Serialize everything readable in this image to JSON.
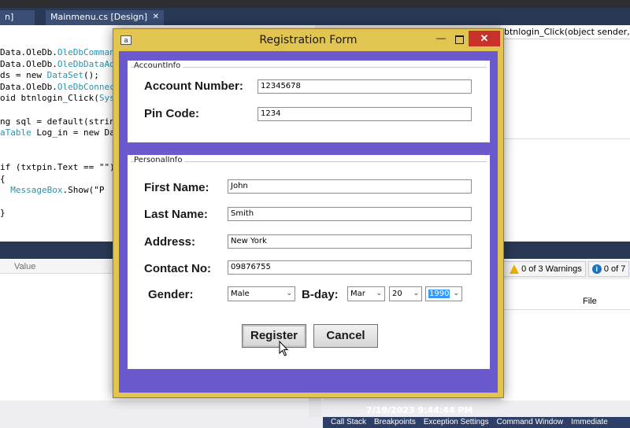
{
  "ide": {
    "tabs": [
      {
        "label": "n]"
      },
      {
        "label": "Mainmenu.cs [Design]"
      }
    ],
    "tab_close_glyph": "✕",
    "method_bar": "btnlogin_Click(object sender, EventArgs e)",
    "code_lines": [
      {
        "pre": "Data.OleDb.",
        "type": "OleDbCommand",
        "post": ""
      },
      {
        "pre": "Data.OleDb.",
        "type": "OleDbDataAda",
        "post": ""
      },
      {
        "pre": "ds = new ",
        "type": "DataSet",
        "post": "();"
      },
      {
        "pre": "Data.OleDb.",
        "type": "OleDbConnect",
        "post": ""
      },
      {
        "pre": "oid btnlogin_Click(",
        "type": "Sys",
        "post": ""
      },
      {
        "pre": "",
        "type": "",
        "post": ""
      },
      {
        "pre": "ng sql = default(strin",
        "type": "",
        "post": ""
      },
      {
        "pre": "",
        "type": "aTable",
        "post": " Log_in = new Dat"
      },
      {
        "pre": "",
        "type": "",
        "post": ""
      },
      {
        "pre": "",
        "type": "",
        "post": ""
      },
      {
        "pre": "if (txtpin.Text == \"\")",
        "type": "",
        "post": ""
      },
      {
        "pre": "{",
        "type": "",
        "post": ""
      },
      {
        "pre": "  ",
        "type": "MessageBox",
        "post": ".Show(\"P"
      },
      {
        "pre": "",
        "type": "",
        "post": ""
      },
      {
        "pre": "}",
        "type": "",
        "post": ""
      }
    ],
    "value_header": "Value",
    "warnings_label": "0 of 3 Warnings",
    "messages_label": "0 of 7",
    "file_header": "File",
    "bottom_tabs": [
      "Call Stack",
      "Breakpoints",
      "Exception Settings",
      "Command Window",
      "Immediate"
    ]
  },
  "window": {
    "icon_glyph": "a",
    "title": "Registration Form",
    "minimize_glyph": "—",
    "close_glyph": "✕"
  },
  "account_group": {
    "label": "AccountInfo",
    "account_number_label": "Account Number:",
    "account_number_value": "12345678",
    "pin_code_label": "Pin Code:",
    "pin_code_value": "1234"
  },
  "personal_group": {
    "label": "PersonalInfo",
    "first_name_label": "First Name:",
    "first_name_value": "John",
    "last_name_label": "Last Name:",
    "last_name_value": "Smith",
    "address_label": "Address:",
    "address_value": "New York",
    "contact_label": "Contact No:",
    "contact_value": "09876755",
    "gender_label": "Gender:",
    "gender_value": "Male",
    "bday_label": "B-day:",
    "month_value": "Mar",
    "day_value": "20",
    "year_value": "1990",
    "dropdown_glyph": "⌄"
  },
  "buttons": {
    "register": "Register",
    "cancel": "Cancel"
  },
  "datetime": "7/19/2023 9:44:44 PM",
  "colors": {
    "form_background": "#6a5acd",
    "window_frame": "#e2c550",
    "close_button": "#c7312a",
    "ide_tabbar": "#293955"
  }
}
